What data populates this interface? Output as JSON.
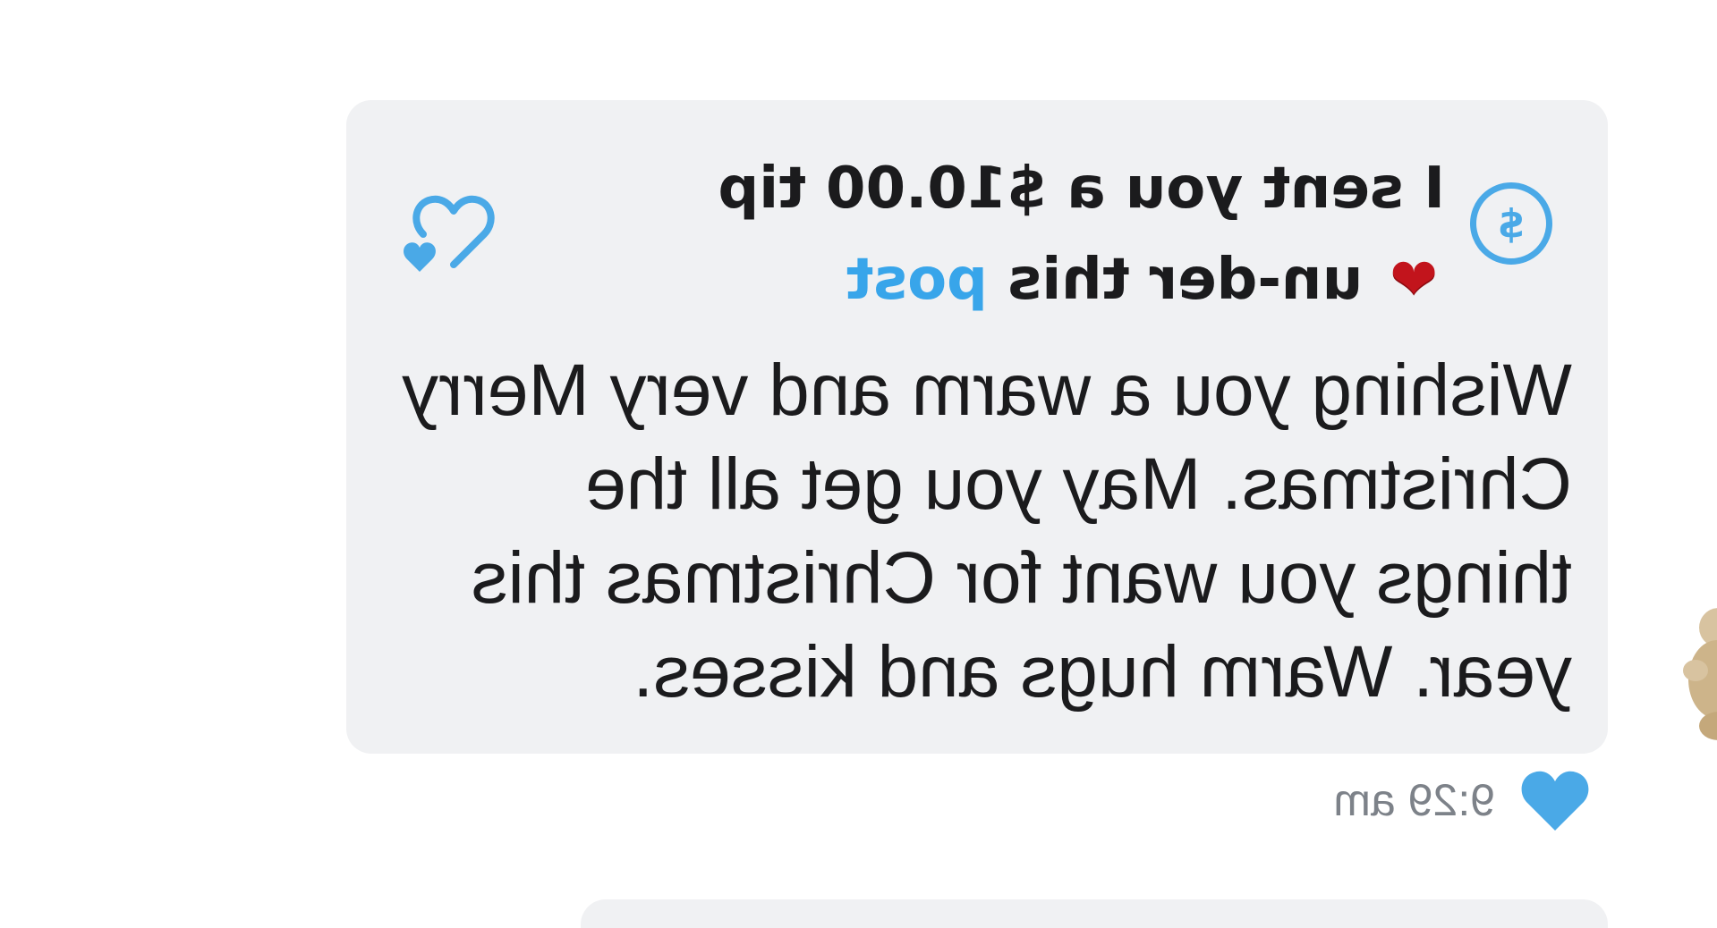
{
  "message": {
    "tip": {
      "icon": "dollar-circle-icon",
      "icon_glyph": "$",
      "text_before_heart": "I sent you a $10.00 tip",
      "heart_emoji": "❤",
      "text_after_heart": "un-der this",
      "link_text": "post"
    },
    "body": "Wishing you a warm and very Merry Christmas. May you get all the things you want for Christmas this year. Warm hugs and kisses.",
    "like_button_icon": "heart-outline-icon",
    "liked_icon": "heart-filled-icon",
    "timestamp": "9:29 am"
  },
  "colors": {
    "accent": "#4aa9e7",
    "bubble_background": "#f0f1f3",
    "text": "#1b1b1d",
    "timestamp": "#7d8289",
    "heart_emoji": "#c2141c"
  }
}
